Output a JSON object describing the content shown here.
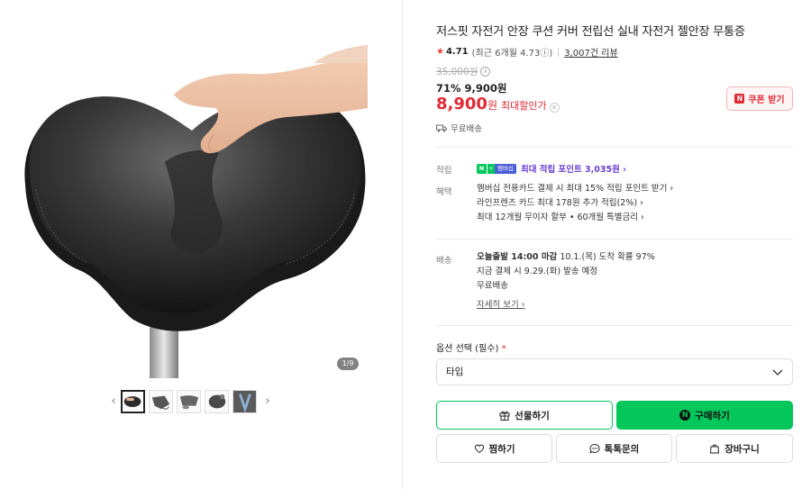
{
  "gallery": {
    "page_indicator": "1/9",
    "prev_label": "‹",
    "next_label": "›",
    "thumbnails": [
      "thumb-1",
      "thumb-2",
      "thumb-3",
      "thumb-4",
      "thumb-5"
    ]
  },
  "product": {
    "title": "저스핏 자전거 안장 쿠션 커버 전립선 실내 자전거 젤안장 무통증",
    "rating": "4.71",
    "rating_recent": "(최근 6개월 4.73",
    "rating_icon": "ⓘ)",
    "review_count": "3,007건 리뷰",
    "original_price": "35,000원",
    "discount_line": "71% 9,900원",
    "final_price": "8,900",
    "final_unit": "원",
    "max_discount_label": "최대할인가",
    "coupon_label": "쿠폰 받기",
    "free_shipping_top": "무료배송"
  },
  "points": {
    "label": "적립",
    "badge_n": "N",
    "badge_plus": "+",
    "badge_member": "멤버십",
    "text": "최대 적립 포인트 3,035원 ›"
  },
  "benefits": {
    "label": "혜택",
    "lines": [
      "멤버십 전용카드 결제 시 최대 15% 적립 포인트 받기 ›",
      "라인프렌즈 카드 최대 178원 추가 적립(2%) ›",
      "최대 12개월 무이자 할부 • 60개월 특별금리 ›"
    ]
  },
  "shipping": {
    "label": "배송",
    "line1_bold": "오늘출발 14:00 마감",
    "line1_rest": "  10.1.(목) 도착 확률 97%",
    "line2": "지금 결제 시 9.29.(화) 발송 예정",
    "line3": "무료배송",
    "detail_link": "자세히 보기 ›"
  },
  "options": {
    "label": "옵션 선택 (필수)",
    "required_mark": "*",
    "select_value": "타입"
  },
  "actions": {
    "gift": "선물하기",
    "buy_icon": "N",
    "buy": "구매하기",
    "like": "찜하기",
    "talk": "톡톡문의",
    "cart": "장바구니"
  },
  "colors": {
    "accent_green": "#03c75a",
    "price_red": "#e02a34",
    "points_purple": "#6b3fd1"
  }
}
